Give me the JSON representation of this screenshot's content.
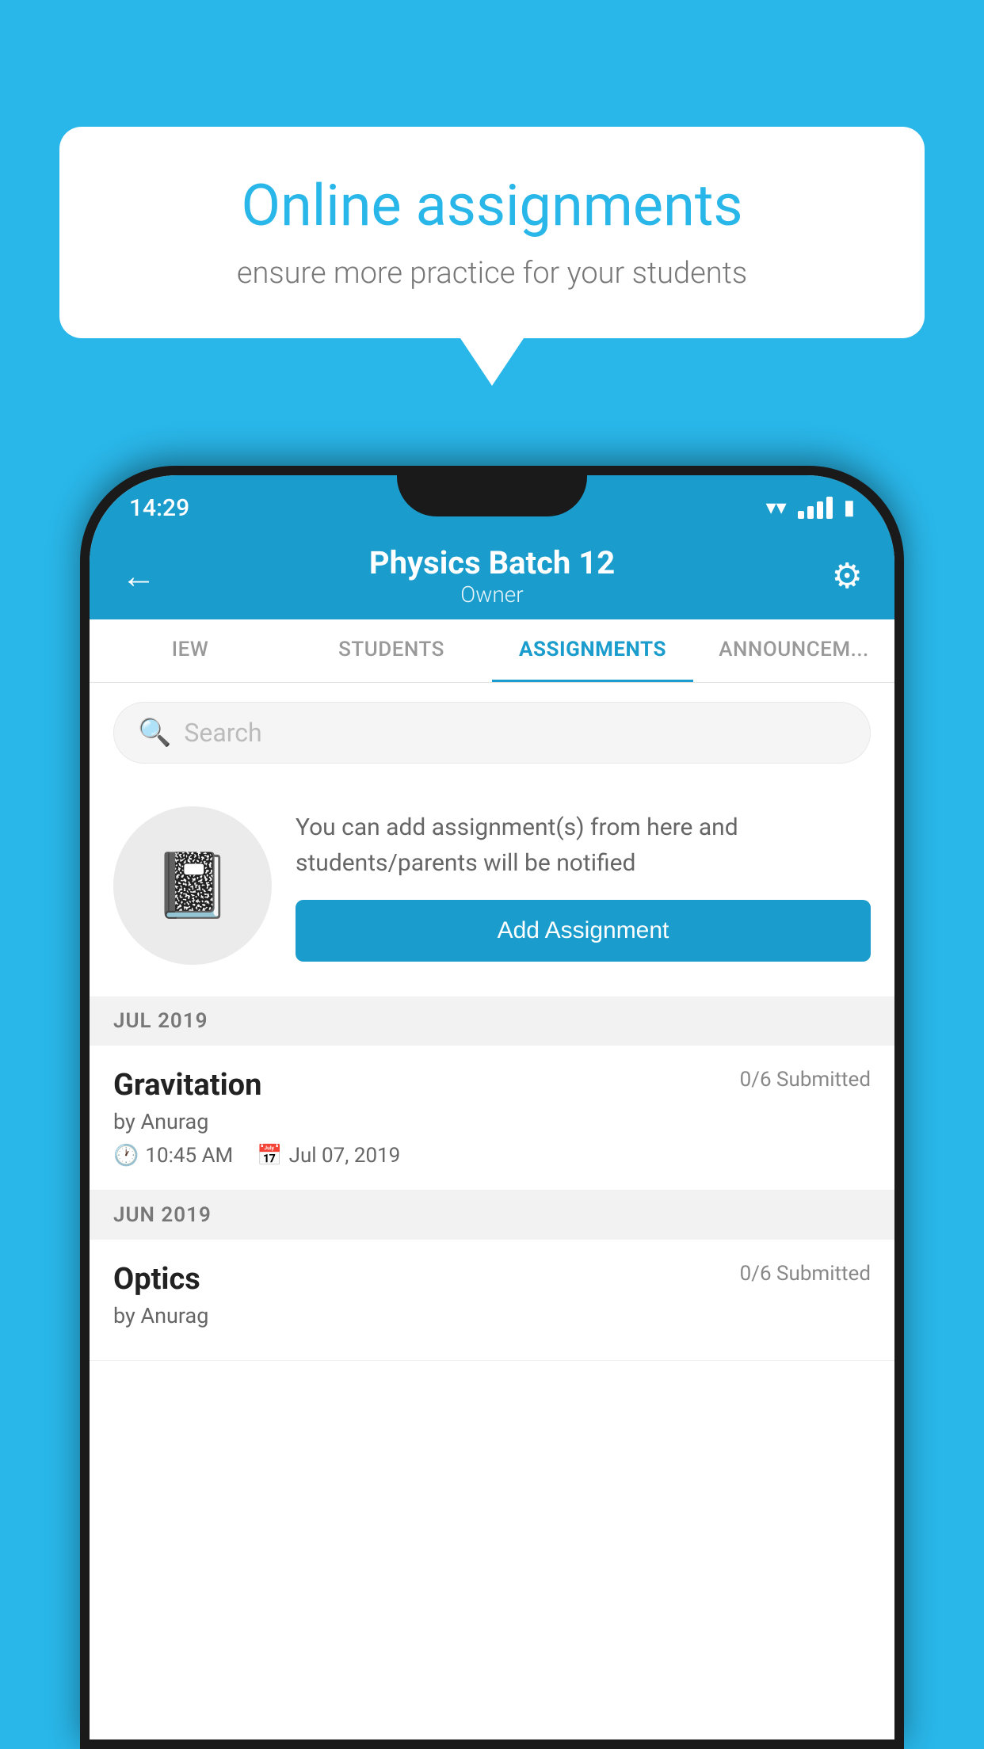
{
  "background": {
    "color": "#29b6e8"
  },
  "speech_bubble": {
    "title": "Online assignments",
    "subtitle": "ensure more practice for your students"
  },
  "status_bar": {
    "time": "14:29"
  },
  "header": {
    "title": "Physics Batch 12",
    "subtitle": "Owner",
    "back_label": "←",
    "settings_label": "⚙"
  },
  "tabs": [
    {
      "id": "overview",
      "label": "IEW",
      "active": false
    },
    {
      "id": "students",
      "label": "STUDENTS",
      "active": false
    },
    {
      "id": "assignments",
      "label": "ASSIGNMENTS",
      "active": true
    },
    {
      "id": "announcements",
      "label": "ANNOUNCEM...",
      "active": false
    }
  ],
  "search": {
    "placeholder": "Search"
  },
  "notice": {
    "text": "You can add assignment(s) from here and students/parents will be notified",
    "button_label": "Add Assignment"
  },
  "sections": [
    {
      "header": "JUL 2019",
      "assignments": [
        {
          "title": "Gravitation",
          "status": "0/6 Submitted",
          "author": "by Anurag",
          "time": "10:45 AM",
          "date": "Jul 07, 2019"
        }
      ]
    },
    {
      "header": "JUN 2019",
      "assignments": [
        {
          "title": "Optics",
          "status": "0/6 Submitted",
          "author": "by Anurag",
          "time": "",
          "date": ""
        }
      ]
    }
  ]
}
